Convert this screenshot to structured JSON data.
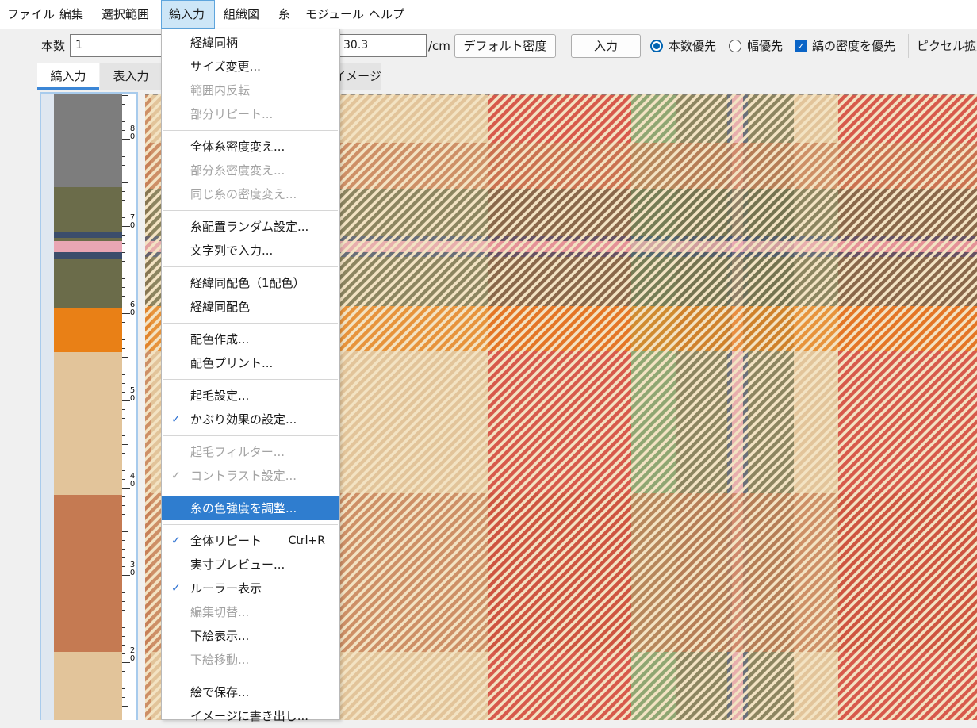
{
  "menubar": {
    "items": [
      "ファイル",
      "編集",
      "選択範囲",
      "縞入力",
      "組織図",
      "糸",
      "モジュール",
      "ヘルプ"
    ],
    "active": "縞入力"
  },
  "toolbar": {
    "count_label": "本数",
    "count_value": "1",
    "density_value": "30.3",
    "density_unit": "/cm",
    "default_density_button": "デフォルト密度",
    "input_button": "入力",
    "radio_count_priority": "本数優先",
    "radio_width_priority": "幅優先",
    "check_stripe_density": "縞の密度を優先",
    "pixel_zoom_label": "ピクセル拡大"
  },
  "tabs": [
    "縞入力",
    "表入力",
    "イメージ"
  ],
  "ruler": {
    "labels": [
      "8\n0",
      "7\n0",
      "6\n0",
      "5\n0",
      "4\n0",
      "3\n0",
      "2\n0"
    ]
  },
  "stripe_colors": {
    "gray": "#7d7d7d",
    "olive": "#6b6c4a",
    "navy": "#3b4d6b",
    "pink": "#e9a6b4",
    "orange": "#e98016",
    "tan": "#e2c49a",
    "rust": "#c57a52",
    "red": "#d3302c",
    "green": "#6f9a62",
    "cream": "#f3e3c3"
  },
  "dropdown": {
    "items": [
      {
        "label": "経緯同柄"
      },
      {
        "label": "サイズ変更..."
      },
      {
        "label": "範囲内反転",
        "disabled": true
      },
      {
        "label": "部分リピート...",
        "disabled": true
      },
      {
        "sep": true
      },
      {
        "label": "全体糸密度変え..."
      },
      {
        "label": "部分糸密度変え...",
        "disabled": true
      },
      {
        "label": "同じ糸の密度変え...",
        "disabled": true
      },
      {
        "sep": true
      },
      {
        "label": "糸配置ランダム設定..."
      },
      {
        "label": "文字列で入力..."
      },
      {
        "sep": true
      },
      {
        "label": "経緯同配色（1配色）"
      },
      {
        "label": "経緯同配色"
      },
      {
        "sep": true
      },
      {
        "label": "配色作成..."
      },
      {
        "label": "配色プリント..."
      },
      {
        "sep": true
      },
      {
        "label": "起毛設定..."
      },
      {
        "label": "かぶり効果の設定...",
        "checked": true
      },
      {
        "sep": true
      },
      {
        "label": "起毛フィルター...",
        "disabled": true
      },
      {
        "label": "コントラスト設定...",
        "disabled": true,
        "checked": true
      },
      {
        "sep": true
      },
      {
        "label": "糸の色強度を調整...",
        "highlighted": true
      },
      {
        "sep": true
      },
      {
        "label": "全体リピート",
        "checked": true,
        "shortcut": "Ctrl+R"
      },
      {
        "label": "実寸プレビュー..."
      },
      {
        "label": "ルーラー表示",
        "checked": true
      },
      {
        "label": "編集切替...",
        "disabled": true
      },
      {
        "label": "下絵表示..."
      },
      {
        "label": "下絵移動...",
        "disabled": true
      },
      {
        "sep": true
      },
      {
        "label": "絵で保存..."
      },
      {
        "label": "イメージに書き出し..."
      }
    ]
  },
  "icons": {
    "check": "checkmark-icon",
    "radio_on": "radio-selected-icon",
    "radio_off": "radio-unselected-icon",
    "checkbox": "checkbox-checked-icon"
  }
}
